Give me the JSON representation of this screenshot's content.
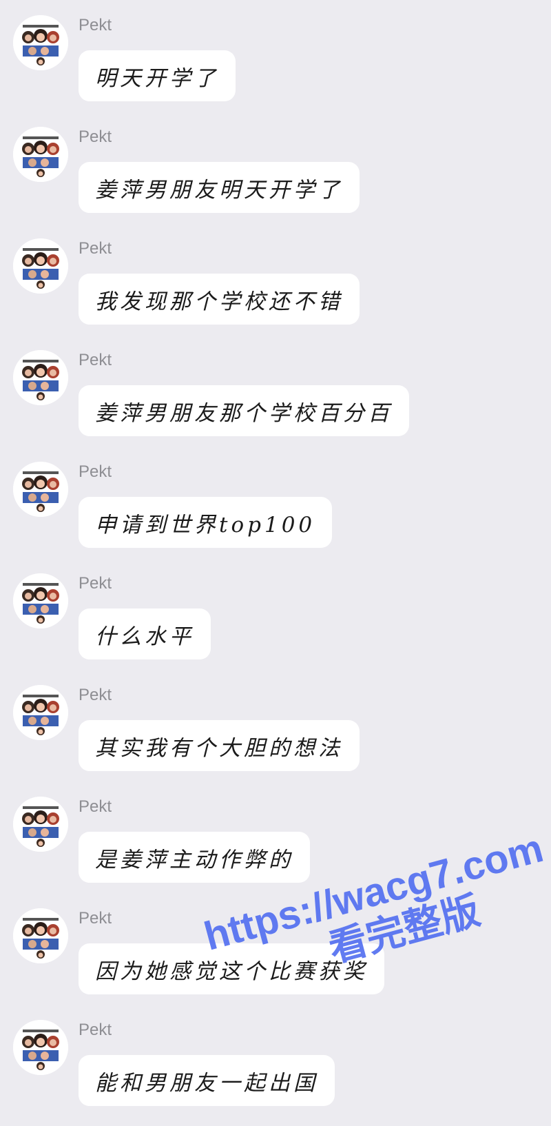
{
  "messages": [
    {
      "sender": "Pekt",
      "text": "明天开学了"
    },
    {
      "sender": "Pekt",
      "text": "姜萍男朋友明天开学了"
    },
    {
      "sender": "Pekt",
      "text": "我发现那个学校还不错"
    },
    {
      "sender": "Pekt",
      "text": "姜萍男朋友那个学校百分百"
    },
    {
      "sender": "Pekt",
      "text": "申请到世界top100"
    },
    {
      "sender": "Pekt",
      "text": "什么水平"
    },
    {
      "sender": "Pekt",
      "text": "其实我有个大胆的想法"
    },
    {
      "sender": "Pekt",
      "text": "是姜萍主动作弊的"
    },
    {
      "sender": "Pekt",
      "text": "因为她感觉这个比赛获奖"
    },
    {
      "sender": "Pekt",
      "text": "能和男朋友一起出国"
    }
  ],
  "watermark": {
    "url": "https://wacg7.com",
    "text": "看完整版",
    "color": "#5470f0"
  },
  "colors": {
    "background": "#ecebf0",
    "bubble": "#ffffff",
    "sender": "#8e8e93"
  }
}
